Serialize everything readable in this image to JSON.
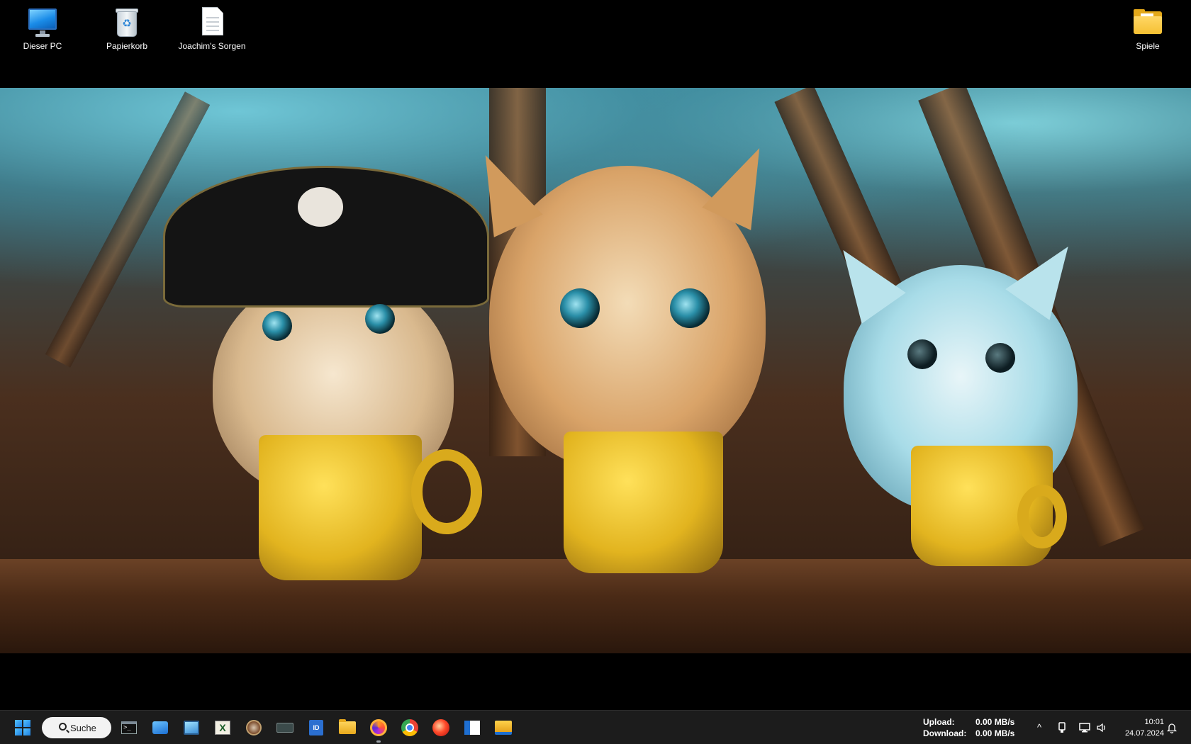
{
  "desktop": {
    "icons": [
      {
        "label": "Dieser PC",
        "icon": "monitor-icon"
      },
      {
        "label": "Papierkorb",
        "icon": "recycle-bin-icon"
      },
      {
        "label": "Joachim's Sorgen",
        "icon": "text-document-icon"
      },
      {
        "label": "Spiele",
        "icon": "folder-icon"
      }
    ]
  },
  "taskbar": {
    "search_label": "Suche",
    "apps": [
      {
        "name": "terminal",
        "icon": "terminal-icon",
        "glyph": ">_"
      },
      {
        "name": "app-blue",
        "icon": "window-app-icon"
      },
      {
        "name": "remote-desktop",
        "icon": "remote-desktop-icon"
      },
      {
        "name": "spreadsheet",
        "icon": "spreadsheet-icon",
        "glyph": "X"
      },
      {
        "name": "round-app",
        "icon": "round-app-icon"
      },
      {
        "name": "keyboard-app",
        "icon": "keyboard-icon"
      },
      {
        "name": "id-app",
        "icon": "id-card-icon",
        "glyph": "ID"
      },
      {
        "name": "file-explorer-folder",
        "icon": "folder-icon"
      },
      {
        "name": "firefox",
        "icon": "firefox-icon",
        "active": true
      },
      {
        "name": "chrome",
        "icon": "chrome-icon"
      },
      {
        "name": "media-player",
        "icon": "media-player-icon"
      },
      {
        "name": "windows-app",
        "icon": "windows-app-icon"
      },
      {
        "name": "file-explorer",
        "icon": "file-explorer-icon"
      }
    ],
    "network": {
      "upload_label": "Upload:",
      "upload_value": "0.00 MB/s",
      "download_label": "Download:",
      "download_value": "0.00 MB/s"
    },
    "tray": {
      "chevron": "^",
      "usb_icon": "usb-icon",
      "network_icon": "network-icon",
      "volume_icon": "volume-icon",
      "notification_icon": "bell-icon"
    },
    "clock": {
      "time": "10:01",
      "date": "24.07.2024"
    }
  },
  "colors": {
    "background": "#000000",
    "taskbar": "#1c1c1c",
    "accent": "#1e7fe0"
  }
}
